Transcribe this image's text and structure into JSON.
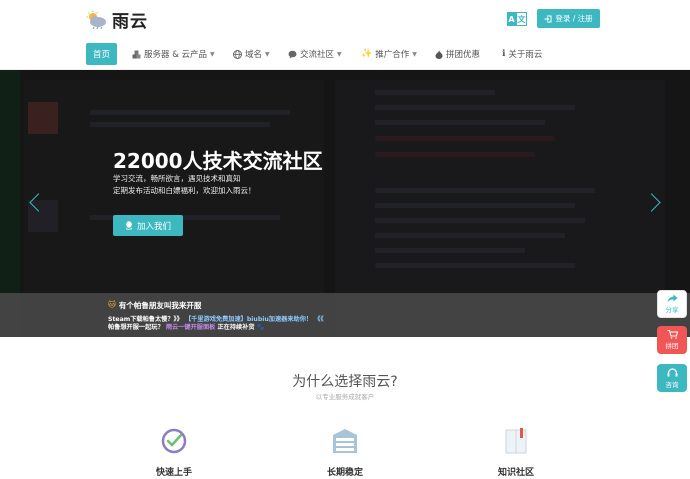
{
  "header": {
    "brand": "雨云",
    "lang_toggle": [
      "A",
      "文"
    ],
    "login_label": "登录 / 注册"
  },
  "nav": {
    "items": [
      {
        "label": "首页",
        "icon": "",
        "dropdown": false,
        "active": true
      },
      {
        "label": "服务器 & 云产品",
        "icon": "cubes-icon",
        "dropdown": true
      },
      {
        "label": "域名",
        "icon": "globe-icon",
        "dropdown": true
      },
      {
        "label": "交流社区",
        "icon": "chat-icon",
        "dropdown": true
      },
      {
        "label": "推广合作",
        "icon": "sparkle-icon",
        "dropdown": true
      },
      {
        "label": "拼团优惠",
        "icon": "fire-icon",
        "dropdown": false
      },
      {
        "label": "关于雨云",
        "icon": "info-icon",
        "dropdown": false
      }
    ]
  },
  "hero": {
    "title": "22000人技术交流社区",
    "subtitle_line1": "学习交流，畅所欲言，遇见技术和真知",
    "subtitle_line2": "定期发布活动和白嫖福利，欢迎加入雨云！",
    "join_label": "加入我们"
  },
  "notice": {
    "title": "有个帕鲁朋友叫我来开服",
    "line1_a": "Steam下载帕鲁太慢？》》",
    "line1_b": "【千里游戏免费加速】biubiu加速器来助你！",
    "line1_c": "《《",
    "line2_a": "帕鲁想开服一起玩？",
    "line2_b": "雨云一键开服面板",
    "line2_c": "正在持续补货"
  },
  "side_buttons": {
    "share": "分享",
    "group": "拼团",
    "consult": "咨询"
  },
  "why": {
    "title": "为什么选择雨云?",
    "subtitle": "以专业服务成就客户",
    "features": [
      {
        "label": "快速上手",
        "icon": "check-circle-icon"
      },
      {
        "label": "长期稳定",
        "icon": "server-icon"
      },
      {
        "label": "知识社区",
        "icon": "book-icon"
      }
    ]
  },
  "colors": {
    "accent": "#3db8c0",
    "group_red": "#f05656",
    "hero_bg": "#151515"
  }
}
